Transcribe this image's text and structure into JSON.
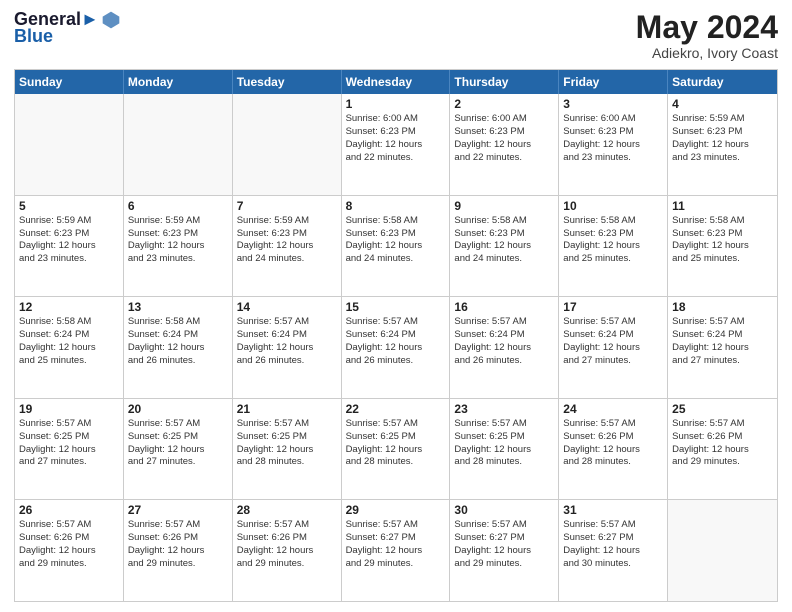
{
  "header": {
    "logo_line1": "General",
    "logo_line2": "Blue",
    "month_title": "May 2024",
    "location": "Adiekro, Ivory Coast"
  },
  "weekdays": [
    "Sunday",
    "Monday",
    "Tuesday",
    "Wednesday",
    "Thursday",
    "Friday",
    "Saturday"
  ],
  "weeks": [
    [
      {
        "day": "",
        "info": ""
      },
      {
        "day": "",
        "info": ""
      },
      {
        "day": "",
        "info": ""
      },
      {
        "day": "1",
        "info": "Sunrise: 6:00 AM\nSunset: 6:23 PM\nDaylight: 12 hours\nand 22 minutes."
      },
      {
        "day": "2",
        "info": "Sunrise: 6:00 AM\nSunset: 6:23 PM\nDaylight: 12 hours\nand 22 minutes."
      },
      {
        "day": "3",
        "info": "Sunrise: 6:00 AM\nSunset: 6:23 PM\nDaylight: 12 hours\nand 23 minutes."
      },
      {
        "day": "4",
        "info": "Sunrise: 5:59 AM\nSunset: 6:23 PM\nDaylight: 12 hours\nand 23 minutes."
      }
    ],
    [
      {
        "day": "5",
        "info": "Sunrise: 5:59 AM\nSunset: 6:23 PM\nDaylight: 12 hours\nand 23 minutes."
      },
      {
        "day": "6",
        "info": "Sunrise: 5:59 AM\nSunset: 6:23 PM\nDaylight: 12 hours\nand 23 minutes."
      },
      {
        "day": "7",
        "info": "Sunrise: 5:59 AM\nSunset: 6:23 PM\nDaylight: 12 hours\nand 24 minutes."
      },
      {
        "day": "8",
        "info": "Sunrise: 5:58 AM\nSunset: 6:23 PM\nDaylight: 12 hours\nand 24 minutes."
      },
      {
        "day": "9",
        "info": "Sunrise: 5:58 AM\nSunset: 6:23 PM\nDaylight: 12 hours\nand 24 minutes."
      },
      {
        "day": "10",
        "info": "Sunrise: 5:58 AM\nSunset: 6:23 PM\nDaylight: 12 hours\nand 25 minutes."
      },
      {
        "day": "11",
        "info": "Sunrise: 5:58 AM\nSunset: 6:23 PM\nDaylight: 12 hours\nand 25 minutes."
      }
    ],
    [
      {
        "day": "12",
        "info": "Sunrise: 5:58 AM\nSunset: 6:24 PM\nDaylight: 12 hours\nand 25 minutes."
      },
      {
        "day": "13",
        "info": "Sunrise: 5:58 AM\nSunset: 6:24 PM\nDaylight: 12 hours\nand 26 minutes."
      },
      {
        "day": "14",
        "info": "Sunrise: 5:57 AM\nSunset: 6:24 PM\nDaylight: 12 hours\nand 26 minutes."
      },
      {
        "day": "15",
        "info": "Sunrise: 5:57 AM\nSunset: 6:24 PM\nDaylight: 12 hours\nand 26 minutes."
      },
      {
        "day": "16",
        "info": "Sunrise: 5:57 AM\nSunset: 6:24 PM\nDaylight: 12 hours\nand 26 minutes."
      },
      {
        "day": "17",
        "info": "Sunrise: 5:57 AM\nSunset: 6:24 PM\nDaylight: 12 hours\nand 27 minutes."
      },
      {
        "day": "18",
        "info": "Sunrise: 5:57 AM\nSunset: 6:24 PM\nDaylight: 12 hours\nand 27 minutes."
      }
    ],
    [
      {
        "day": "19",
        "info": "Sunrise: 5:57 AM\nSunset: 6:25 PM\nDaylight: 12 hours\nand 27 minutes."
      },
      {
        "day": "20",
        "info": "Sunrise: 5:57 AM\nSunset: 6:25 PM\nDaylight: 12 hours\nand 27 minutes."
      },
      {
        "day": "21",
        "info": "Sunrise: 5:57 AM\nSunset: 6:25 PM\nDaylight: 12 hours\nand 28 minutes."
      },
      {
        "day": "22",
        "info": "Sunrise: 5:57 AM\nSunset: 6:25 PM\nDaylight: 12 hours\nand 28 minutes."
      },
      {
        "day": "23",
        "info": "Sunrise: 5:57 AM\nSunset: 6:25 PM\nDaylight: 12 hours\nand 28 minutes."
      },
      {
        "day": "24",
        "info": "Sunrise: 5:57 AM\nSunset: 6:26 PM\nDaylight: 12 hours\nand 28 minutes."
      },
      {
        "day": "25",
        "info": "Sunrise: 5:57 AM\nSunset: 6:26 PM\nDaylight: 12 hours\nand 29 minutes."
      }
    ],
    [
      {
        "day": "26",
        "info": "Sunrise: 5:57 AM\nSunset: 6:26 PM\nDaylight: 12 hours\nand 29 minutes."
      },
      {
        "day": "27",
        "info": "Sunrise: 5:57 AM\nSunset: 6:26 PM\nDaylight: 12 hours\nand 29 minutes."
      },
      {
        "day": "28",
        "info": "Sunrise: 5:57 AM\nSunset: 6:26 PM\nDaylight: 12 hours\nand 29 minutes."
      },
      {
        "day": "29",
        "info": "Sunrise: 5:57 AM\nSunset: 6:27 PM\nDaylight: 12 hours\nand 29 minutes."
      },
      {
        "day": "30",
        "info": "Sunrise: 5:57 AM\nSunset: 6:27 PM\nDaylight: 12 hours\nand 29 minutes."
      },
      {
        "day": "31",
        "info": "Sunrise: 5:57 AM\nSunset: 6:27 PM\nDaylight: 12 hours\nand 30 minutes."
      },
      {
        "day": "",
        "info": ""
      }
    ]
  ]
}
